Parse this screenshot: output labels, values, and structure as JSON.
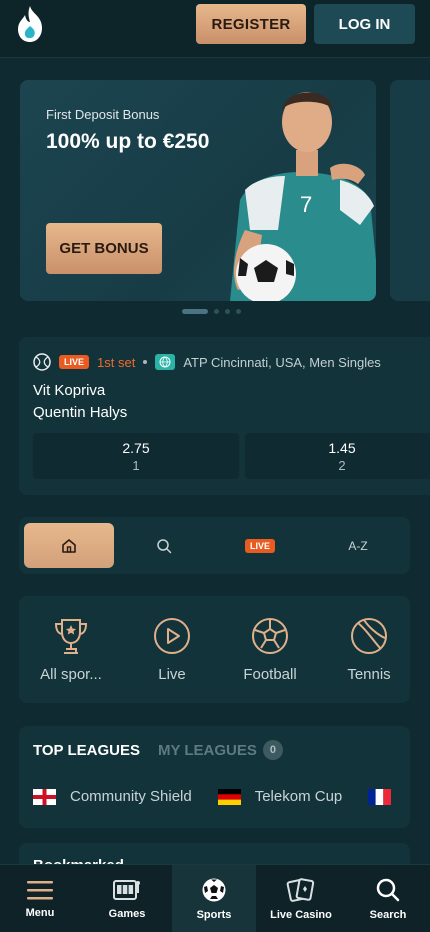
{
  "header": {
    "register_label": "REGISTER",
    "login_label": "LOG IN"
  },
  "banner": {
    "subtitle": "First Deposit Bonus",
    "title": "100% up to €250",
    "cta_label": "GET BONUS",
    "jersey_number": "7"
  },
  "match": {
    "live_badge": "LIVE",
    "set": "1st set",
    "league": "ATP Cincinnati, USA, Men Singles",
    "team1": "Vit Kopriva",
    "team2": "Quentin Halys",
    "odds": [
      {
        "value": "2.75",
        "label": "1"
      },
      {
        "value": "1.45",
        "label": "2"
      }
    ]
  },
  "tabs": {
    "live_label": "LIVE",
    "az_label": "A-Z"
  },
  "sports": [
    {
      "label": "All spor...",
      "icon": "trophy-icon"
    },
    {
      "label": "Live",
      "icon": "play-icon"
    },
    {
      "label": "Football",
      "icon": "football-icon"
    },
    {
      "label": "Tennis",
      "icon": "tennis-icon"
    }
  ],
  "leagues": {
    "top_label": "TOP LEAGUES",
    "my_label": "MY LEAGUES",
    "my_count": "0",
    "items": [
      {
        "name": "Community Shield",
        "flag": "england"
      },
      {
        "name": "Telekom Cup",
        "flag": "germany"
      },
      {
        "name": "",
        "flag": "france"
      }
    ]
  },
  "next_section_title": "Bookmarked",
  "bottom_nav": [
    {
      "label": "Menu",
      "icon": "menu-icon"
    },
    {
      "label": "Games",
      "icon": "slot-machine-icon"
    },
    {
      "label": "Sports",
      "icon": "soccer-ball-icon"
    },
    {
      "label": "Live Casino",
      "icon": "cards-icon"
    },
    {
      "label": "Search",
      "icon": "search-icon"
    }
  ],
  "colors": {
    "background": "#0f2a30",
    "accent": "#e7b88c",
    "live": "#ea5b22"
  }
}
